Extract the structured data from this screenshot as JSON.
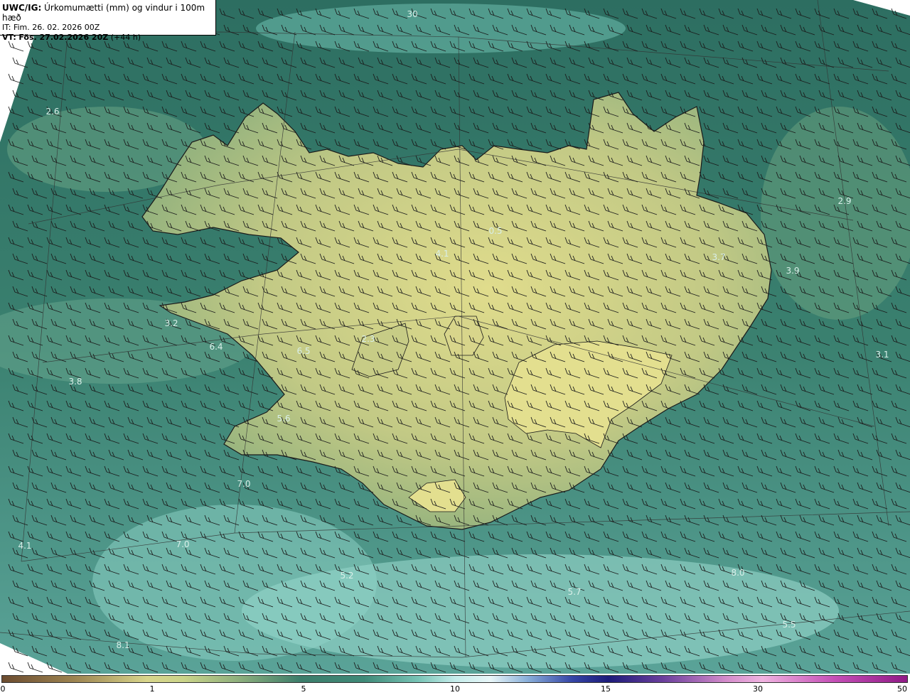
{
  "header": {
    "model": "UWC/IG:",
    "description": "Úrkomumætti (mm) og vindur i 100m hæð",
    "init_time": "IT: Fim. 26. 02. 2026 00Z",
    "valid_label": "VT:",
    "valid_time": "Fös. 27.02.2026 20Z",
    "lead_time": "(+44 h)"
  },
  "value_labels": [
    "30",
    "2.6",
    "2.9",
    "0.5",
    "4.1",
    "3.7",
    "3.9",
    "3.2",
    "6.4",
    "6.5",
    "2.3",
    "3.8",
    "3.1",
    "5.6",
    "7.0",
    "4.1",
    "7.0",
    "5.2",
    "8.0",
    "5.7",
    "5.5",
    "8.1"
  ],
  "colorbar": {
    "ticks": [
      "0",
      "1",
      "5",
      "10",
      "15",
      "30",
      "50"
    ]
  },
  "colors": {
    "ocean": "#2f7466",
    "land_low": "#7fa379",
    "land_high": "#d9d98a",
    "light_cyan": "#9fdcd2",
    "coast": "#1a1a1a"
  }
}
